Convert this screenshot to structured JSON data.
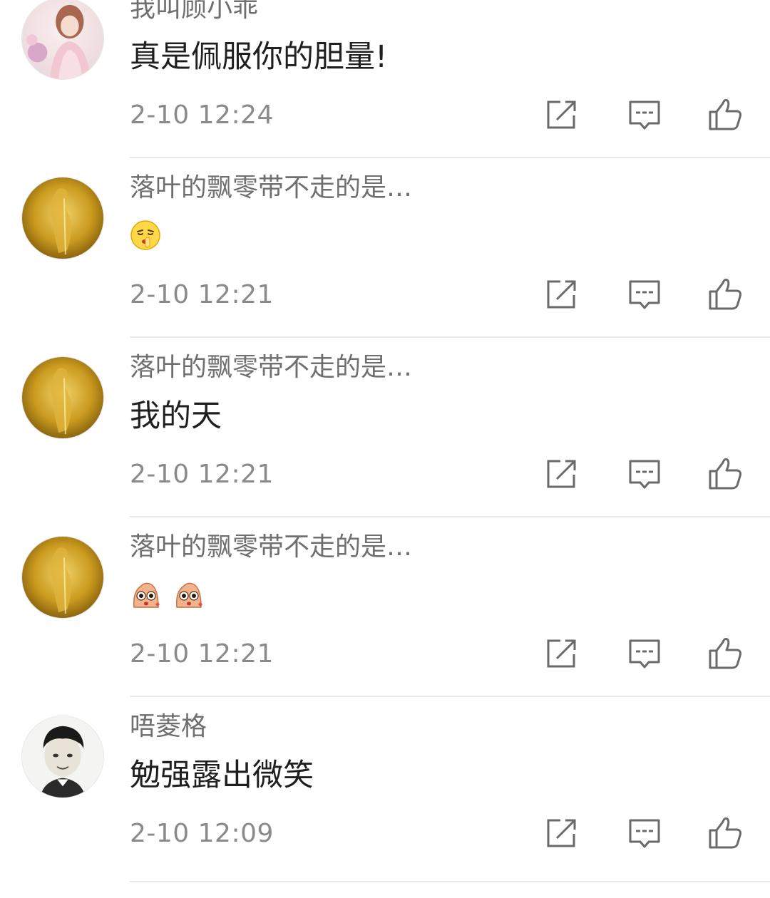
{
  "comments": [
    {
      "username": "我叫顾小乖",
      "content": "真是佩服你的胆量!",
      "time": "2-10 12:24",
      "avatar": "girl-photo-avatar"
    },
    {
      "username": "落叶的飘零带不走的是…",
      "content_icons": [
        "shush-face-emoji"
      ],
      "time": "2-10 12:21",
      "avatar": "golden-figure-avatar"
    },
    {
      "username": "落叶的飘零带不走的是…",
      "content": "我的天",
      "time": "2-10 12:21",
      "avatar": "golden-figure-avatar"
    },
    {
      "username": "落叶的飘零带不走的是…",
      "content_icons": [
        "shocked-cartoon-emoji",
        "shocked-cartoon-emoji"
      ],
      "time": "2-10 12:21",
      "avatar": "golden-figure-avatar"
    },
    {
      "username": "唔菱格",
      "content": "勉强露出微笑",
      "time": "2-10 12:09",
      "avatar": "boy-photo-avatar"
    }
  ],
  "actions": {
    "share_icon": "share-icon",
    "reply_icon": "reply-icon",
    "like_icon": "thumbs-up-icon"
  },
  "colors": {
    "username": "#6f6f6f",
    "content": "#1f1f1f",
    "timestamp": "#8a8a8a",
    "icon": "#6a6a6a",
    "divider": "#e9e9e9"
  }
}
